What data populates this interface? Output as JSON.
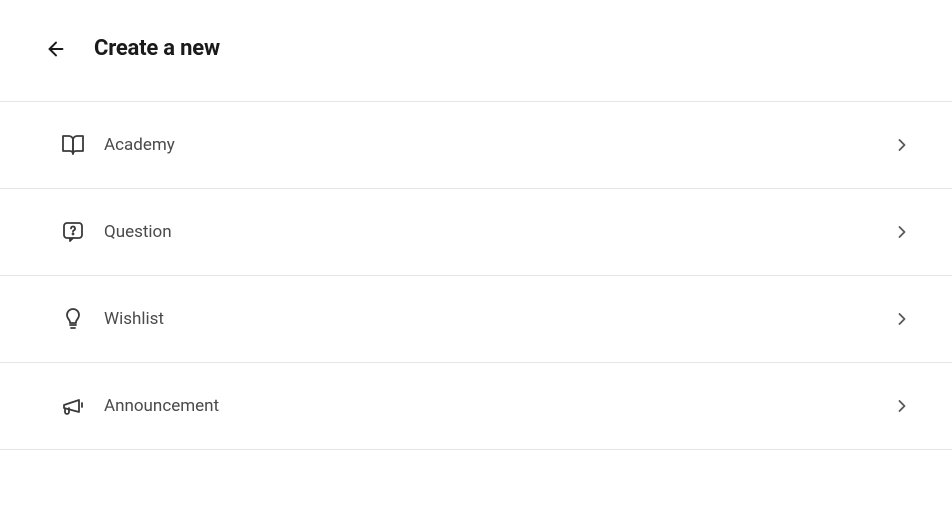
{
  "header": {
    "title": "Create a new"
  },
  "items": [
    {
      "label": "Academy",
      "icon": "book"
    },
    {
      "label": "Question",
      "icon": "question"
    },
    {
      "label": "Wishlist",
      "icon": "lightbulb"
    },
    {
      "label": "Announcement",
      "icon": "megaphone"
    }
  ]
}
